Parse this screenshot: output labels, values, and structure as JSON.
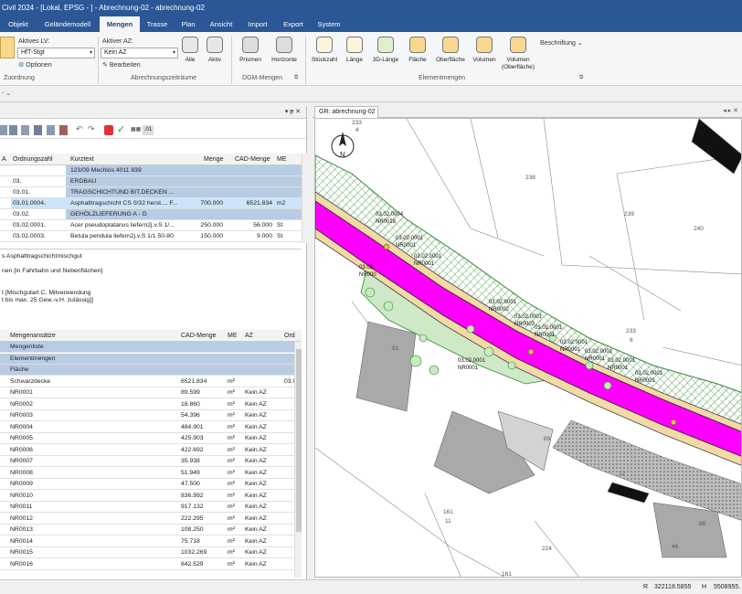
{
  "title": "Civil 2024 - [Lokal, EPSG - ] - Abrechnung-02 - abrechnung-02",
  "menus": [
    "Objekt",
    "Geländemodell",
    "Mengen",
    "Trasse",
    "Plan",
    "Ansicht",
    "Import",
    "Export",
    "System"
  ],
  "active_menu": "Mengen",
  "ribbon": {
    "lv_label": "Aktives LV:",
    "lv_value": "HfT-Stgt",
    "optionen": "Optionen",
    "az_label": "Aktiver AZ:",
    "az_value": "Kein AZ",
    "bearbeiten": "Bearbeiten",
    "alle": "Alle",
    "aktiv": "Aktiv",
    "prismen": "Prismen",
    "horizonte": "Horizonte",
    "stueckzahl": "Stückzahl",
    "laenge": "Länge",
    "laenge3d": "3D-Länge",
    "flaeche": "Fläche",
    "oberflaeche": "Oberfläche",
    "volumen": "Volumen",
    "volumen_ofl_1": "Volumen",
    "volumen_ofl_2": "(Oberfläche)",
    "beschriftung": "Beschriftung",
    "groups": {
      "zuordnung": "Zuordnung",
      "abrechnung": "Abrechnungszeiträume",
      "dgm": "DGM-Mengen",
      "element": "Elementmengen"
    }
  },
  "panel_controls": "▾ ᵽ ✕",
  "lv_table": {
    "headers": [
      "A",
      "Ordnungszahl",
      "Kurztext",
      "Menge",
      "CAD-Menge",
      "ME"
    ],
    "rows": [
      {
        "oz": "",
        "kurztext": "123/09 Mechlos 4011 839",
        "menge": "",
        "cad": "",
        "me": "",
        "style": "blue"
      },
      {
        "oz": "03.",
        "kurztext": "ERDBAU",
        "menge": "",
        "cad": "",
        "me": "",
        "style": "blue"
      },
      {
        "oz": "03.01.",
        "kurztext": "TRAGSCHICHTUND BIT.DECKEN  ...",
        "menge": "",
        "cad": "",
        "me": "",
        "style": "blue"
      },
      {
        "oz": "03.01.0004.",
        "kurztext": "Asphalttragschicht CS 0/32 herst.... F...",
        "menge": "700.000",
        "cad": "6521.834",
        "me": "m2",
        "style": "sel"
      },
      {
        "oz": "03.02.",
        "kurztext": "GEHÖLZLIEFERUNG A - G",
        "menge": "",
        "cad": "",
        "me": "",
        "style": "blue"
      },
      {
        "oz": "03.02.0001.",
        "kurztext": "Acer pseudoplatanus liefern2j.v.S 1/...",
        "menge": "250.000",
        "cad": "56.000",
        "me": "St",
        "style": "plain"
      },
      {
        "oz": "03.02.0003.",
        "kurztext": "Betula pendula liefern2j.v.S 1/1 50-80",
        "menge": "150.000",
        "cad": "9.000",
        "me": "St",
        "style": "plain"
      }
    ]
  },
  "langtext": [
    "s Asphalttragschichtmischgut",
    "",
    "nen [in Fahrbahn und Nebenflächen]",
    "",
    "",
    "t [Mischgutart C. Mitverwendung",
    "t bis max. 25 Gew.-v.H. zulässig]]"
  ],
  "ma_table": {
    "headers": [
      "Mengenansätze",
      "CAD-Menge",
      "ME",
      "AZ",
      "Ord"
    ],
    "group_rows": [
      "Mengenliste",
      "Elementmengen",
      "Fläche"
    ],
    "rows": [
      {
        "name": "Schwarzdecke",
        "cad": "6521.834",
        "me": "m²",
        "az": "",
        "ord": "03.0"
      },
      {
        "name": "NR0001",
        "cad": "89.599",
        "me": "m²",
        "az": "Kein AZ",
        "ord": ""
      },
      {
        "name": "NR0002",
        "cad": "18.860",
        "me": "m²",
        "az": "Kein AZ",
        "ord": ""
      },
      {
        "name": "NR0003",
        "cad": "54.396",
        "me": "m²",
        "az": "Kein AZ",
        "ord": ""
      },
      {
        "name": "NR0004",
        "cad": "484.901",
        "me": "m²",
        "az": "Kein AZ",
        "ord": ""
      },
      {
        "name": "NR0005",
        "cad": "425.903",
        "me": "m²",
        "az": "Kein AZ",
        "ord": ""
      },
      {
        "name": "NR0006",
        "cad": "422.692",
        "me": "m²",
        "az": "Kein AZ",
        "ord": ""
      },
      {
        "name": "NR0007",
        "cad": "35.938",
        "me": "m²",
        "az": "Kein AZ",
        "ord": ""
      },
      {
        "name": "NR0008",
        "cad": "51.949",
        "me": "m²",
        "az": "Kein AZ",
        "ord": ""
      },
      {
        "name": "NR0009",
        "cad": "47.500",
        "me": "m²",
        "az": "Kein AZ",
        "ord": ""
      },
      {
        "name": "NR0010",
        "cad": "836.992",
        "me": "m²",
        "az": "Kein AZ",
        "ord": ""
      },
      {
        "name": "NR0011",
        "cad": "917.132",
        "me": "m²",
        "az": "Kein AZ",
        "ord": ""
      },
      {
        "name": "NR0012",
        "cad": "222.295",
        "me": "m²",
        "az": "Kein AZ",
        "ord": ""
      },
      {
        "name": "NR0013",
        "cad": "108.250",
        "me": "m²",
        "az": "Kein AZ",
        "ord": ""
      },
      {
        "name": "NR0014",
        "cad": "75.718",
        "me": "m²",
        "az": "Kein AZ",
        "ord": ""
      },
      {
        "name": "NR0015",
        "cad": "1032.269",
        "me": "m²",
        "az": "Kein AZ",
        "ord": ""
      },
      {
        "name": "NR0016",
        "cad": "842.529",
        "me": "m²",
        "az": "Kein AZ",
        "ord": ""
      }
    ]
  },
  "map": {
    "tab_title": "GR: abrechnung-02",
    "parcels": [
      "238",
      "239",
      "240",
      "233",
      "6",
      "233",
      "4",
      "161",
      "11",
      "161",
      "224",
      "12",
      "91",
      "89",
      "88",
      "46"
    ],
    "labels": [
      "03.02.0004",
      "NR0018",
      "03.02.0001",
      "NR0001",
      "03.02.0001",
      "NR0001",
      "03.02.",
      "NR000",
      "03.02.0001",
      "NR0002",
      "03.02.0001",
      "NR0003",
      "03.02.0001",
      "NR0001",
      "03.02.0001",
      "NR0001",
      "03.02.0001",
      "NR0001",
      "03.02.0001",
      "NR0001",
      "03.02.0001",
      "NR0001",
      "03.02.0001",
      "NR0001"
    ],
    "north": "N"
  },
  "status": {
    "r_label": "R",
    "r_value": "322118.5855",
    "h_label": "H",
    "h_value": "5508955."
  },
  "colors": {
    "title_bg": "#2b5797",
    "road": "#ff00ff",
    "green": "#3a9a3a",
    "selected": "#cce4f7",
    "blue_row": "#b8cce4"
  }
}
